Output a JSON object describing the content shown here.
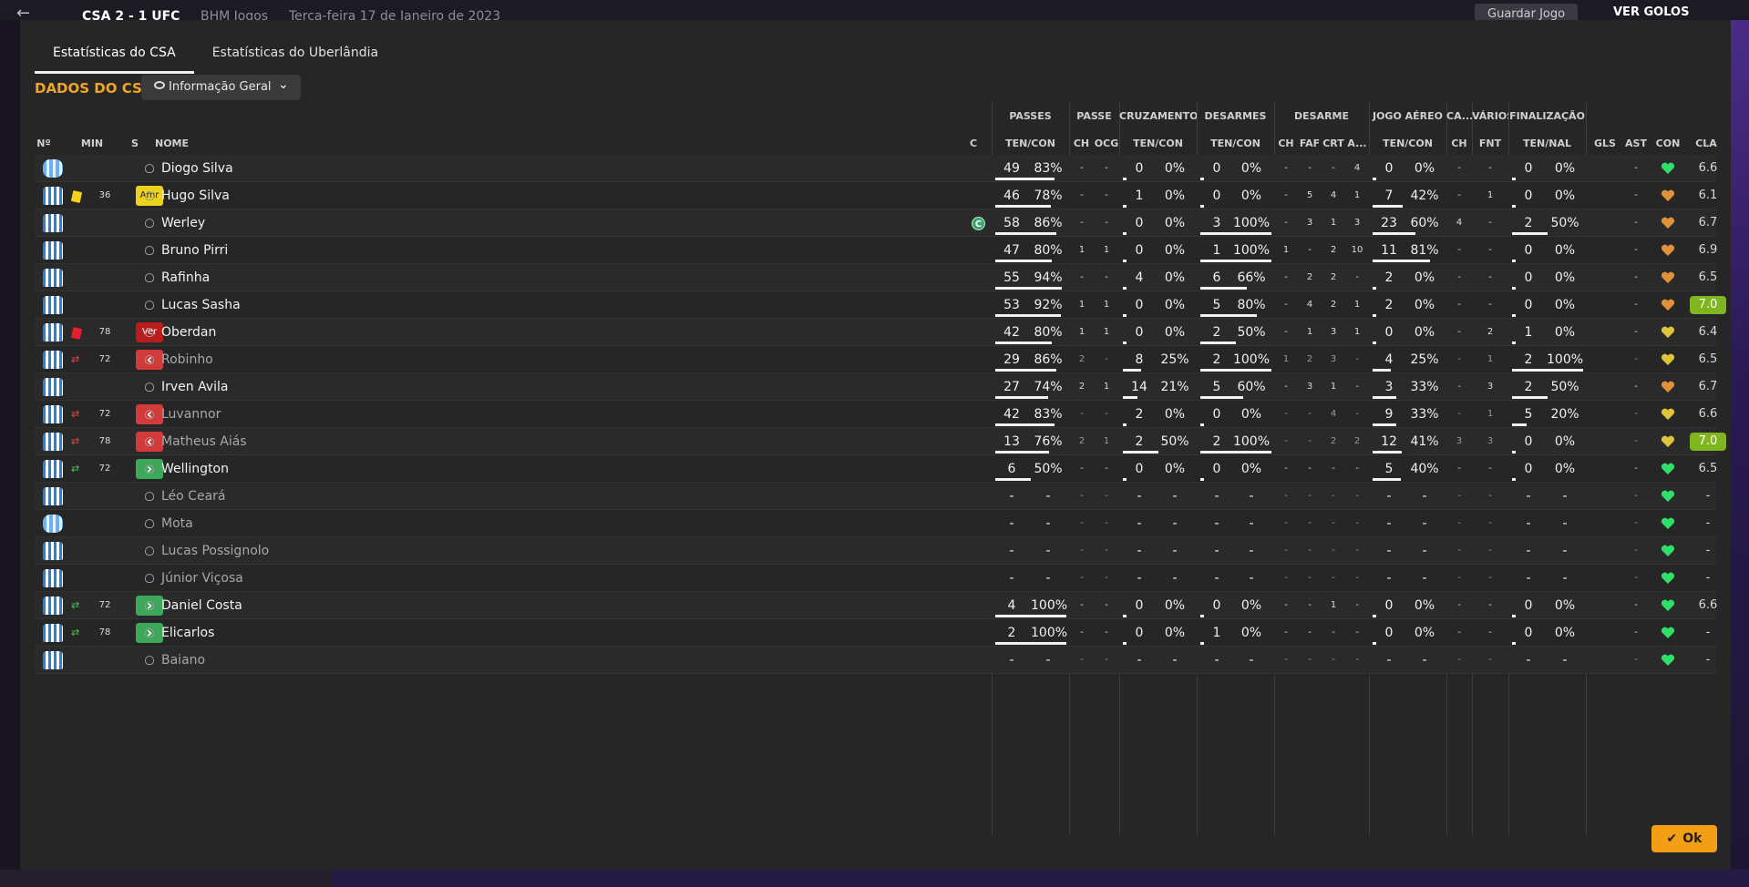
{
  "header": {
    "score": "CSA   2 - 1   UFC",
    "competition": "BHM Jogos",
    "date": "Terça-feira 17 de Janeiro de 2023",
    "save_label": "Guardar Jogo",
    "goals_label": "VER GOLOS"
  },
  "tabs": [
    "Estatísticas do CSA",
    "Estatísticas do Uberlândia"
  ],
  "team_title": "DADOS DO CSA",
  "view_dropdown": "Informação Geral",
  "groups": {
    "passes": "PASSES",
    "passe": "PASSE",
    "cruzamentos": "CRUZAMENTOS",
    "desarmes": "DESARMES",
    "desarme": "DESARME",
    "jogo_aereo": "JOGO AÉREO",
    "ca": "CA...",
    "varios": "VÁRIOS",
    "finalizacao": "FINALIZAÇÃO"
  },
  "columns": {
    "no": "Nº",
    "min": "MIN",
    "s": "S",
    "nome": "NOME",
    "c": "C",
    "pass_tencon": "TEN/CON",
    "pass_ch": "CH",
    "pass_ocg": "OCG",
    "cruz_tencon": "TEN/CON",
    "des_tencon": "TEN/CON",
    "d_ch": "CH",
    "d_faf": "FAF",
    "d_crt": "CRT",
    "d_a": "A...",
    "aer_tencon": "TEN/CON",
    "ca_ch": "CH",
    "v_fnt": "FNT",
    "fin_tennal": "TEN/NAL",
    "gls": "GLS",
    "ast": "AST",
    "con": "CON",
    "cla": "CLA"
  },
  "players": [
    {
      "name": "Diogo Silva",
      "gk": true,
      "event": "",
      "minute": "",
      "badge": "",
      "sub": false,
      "captain": "",
      "p_t": "49",
      "p_p": "83%",
      "pch": "-",
      "ocg": "-",
      "cr_t": "0",
      "cr_p": "0%",
      "de_t": "0",
      "de_p": "0%",
      "d_ch": "-",
      "d_faf": "-",
      "d_crt": "-",
      "d_a": "4",
      "ae_t": "0",
      "ae_p": "0%",
      "ca": "-",
      "fnt": "-",
      "fi_t": "0",
      "fi_p": "0%",
      "gls": "",
      "ast": "-",
      "con": "green",
      "rating": "6.6",
      "hi": false
    },
    {
      "name": "Hugo Silva",
      "gk": false,
      "event": "yellow",
      "minute": "36",
      "badge": "Amr",
      "sub": false,
      "captain": "",
      "p_t": "46",
      "p_p": "78%",
      "pch": "-",
      "ocg": "-",
      "cr_t": "1",
      "cr_p": "0%",
      "de_t": "0",
      "de_p": "0%",
      "d_ch": "-",
      "d_faf": "5",
      "d_crt": "4",
      "d_a": "1",
      "ae_t": "7",
      "ae_p": "42%",
      "ca": "-",
      "fnt": "1",
      "fi_t": "0",
      "fi_p": "0%",
      "gls": "",
      "ast": "-",
      "con": "orange",
      "rating": "6.1",
      "hi": false
    },
    {
      "name": "Werley",
      "gk": false,
      "event": "",
      "minute": "",
      "badge": "",
      "sub": false,
      "captain": "C",
      "p_t": "58",
      "p_p": "86%",
      "pch": "-",
      "ocg": "-",
      "cr_t": "0",
      "cr_p": "0%",
      "de_t": "3",
      "de_p": "100%",
      "d_ch": "-",
      "d_faf": "3",
      "d_crt": "1",
      "d_a": "3",
      "ae_t": "23",
      "ae_p": "60%",
      "ca": "4",
      "fnt": "-",
      "fi_t": "2",
      "fi_p": "50%",
      "gls": "",
      "ast": "-",
      "con": "orange",
      "rating": "6.7",
      "hi": false
    },
    {
      "name": "Bruno Pirri",
      "gk": false,
      "event": "",
      "minute": "",
      "badge": "",
      "sub": false,
      "captain": "",
      "p_t": "47",
      "p_p": "80%",
      "pch": "1",
      "ocg": "1",
      "cr_t": "0",
      "cr_p": "0%",
      "de_t": "1",
      "de_p": "100%",
      "d_ch": "1",
      "d_faf": "-",
      "d_crt": "2",
      "d_a": "10",
      "ae_t": "11",
      "ae_p": "81%",
      "ca": "-",
      "fnt": "-",
      "fi_t": "0",
      "fi_p": "0%",
      "gls": "",
      "ast": "-",
      "con": "orange",
      "rating": "6.9",
      "hi": false
    },
    {
      "name": "Rafinha",
      "gk": false,
      "event": "",
      "minute": "",
      "badge": "",
      "sub": false,
      "captain": "",
      "p_t": "55",
      "p_p": "94%",
      "pch": "-",
      "ocg": "-",
      "cr_t": "4",
      "cr_p": "0%",
      "de_t": "6",
      "de_p": "66%",
      "d_ch": "-",
      "d_faf": "2",
      "d_crt": "2",
      "d_a": "-",
      "ae_t": "2",
      "ae_p": "0%",
      "ca": "-",
      "fnt": "-",
      "fi_t": "0",
      "fi_p": "0%",
      "gls": "",
      "ast": "-",
      "con": "orange",
      "rating": "6.5",
      "hi": false
    },
    {
      "name": "Lucas Sasha",
      "gk": false,
      "event": "",
      "minute": "",
      "badge": "",
      "sub": false,
      "captain": "",
      "p_t": "53",
      "p_p": "92%",
      "pch": "1",
      "ocg": "1",
      "cr_t": "0",
      "cr_p": "0%",
      "de_t": "5",
      "de_p": "80%",
      "d_ch": "-",
      "d_faf": "4",
      "d_crt": "2",
      "d_a": "1",
      "ae_t": "2",
      "ae_p": "0%",
      "ca": "-",
      "fnt": "-",
      "fi_t": "0",
      "fi_p": "0%",
      "gls": "",
      "ast": "-",
      "con": "orange",
      "rating": "7.0",
      "hi": true
    },
    {
      "name": "Oberdan",
      "gk": false,
      "event": "red",
      "minute": "78",
      "badge": "Ver",
      "sub": false,
      "captain": "",
      "p_t": "42",
      "p_p": "80%",
      "pch": "1",
      "ocg": "1",
      "cr_t": "0",
      "cr_p": "0%",
      "de_t": "2",
      "de_p": "50%",
      "d_ch": "-",
      "d_faf": "1",
      "d_crt": "3",
      "d_a": "1",
      "ae_t": "0",
      "ae_p": "0%",
      "ca": "-",
      "fnt": "2",
      "fi_t": "1",
      "fi_p": "0%",
      "gls": "",
      "ast": "-",
      "con": "yellow",
      "rating": "6.4",
      "hi": false
    },
    {
      "name": "Robinho",
      "gk": false,
      "event": "swap-out",
      "minute": "72",
      "badge": "out",
      "sub": true,
      "captain": "",
      "p_t": "29",
      "p_p": "86%",
      "pch": "2",
      "ocg": "-",
      "cr_t": "8",
      "cr_p": "25%",
      "de_t": "2",
      "de_p": "100%",
      "d_ch": "1",
      "d_faf": "2",
      "d_crt": "3",
      "d_a": "-",
      "ae_t": "4",
      "ae_p": "25%",
      "ca": "-",
      "fnt": "1",
      "fi_t": "2",
      "fi_p": "100%",
      "gls": "",
      "ast": "-",
      "con": "yellow",
      "rating": "6.5",
      "hi": false
    },
    {
      "name": "Irven Avila",
      "gk": false,
      "event": "",
      "minute": "",
      "badge": "",
      "sub": false,
      "captain": "",
      "p_t": "27",
      "p_p": "74%",
      "pch": "2",
      "ocg": "1",
      "cr_t": "14",
      "cr_p": "21%",
      "de_t": "5",
      "de_p": "60%",
      "d_ch": "-",
      "d_faf": "3",
      "d_crt": "1",
      "d_a": "-",
      "ae_t": "3",
      "ae_p": "33%",
      "ca": "-",
      "fnt": "3",
      "fi_t": "2",
      "fi_p": "50%",
      "gls": "",
      "ast": "-",
      "con": "orange",
      "rating": "6.7",
      "hi": false
    },
    {
      "name": "Luvannor",
      "gk": false,
      "event": "swap-out",
      "minute": "72",
      "badge": "out",
      "sub": true,
      "captain": "",
      "p_t": "42",
      "p_p": "83%",
      "pch": "-",
      "ocg": "-",
      "cr_t": "2",
      "cr_p": "0%",
      "de_t": "0",
      "de_p": "0%",
      "d_ch": "-",
      "d_faf": "-",
      "d_crt": "4",
      "d_a": "-",
      "ae_t": "9",
      "ae_p": "33%",
      "ca": "-",
      "fnt": "1",
      "fi_t": "5",
      "fi_p": "20%",
      "gls": "",
      "ast": "-",
      "con": "yellow",
      "rating": "6.6",
      "hi": false
    },
    {
      "name": "Matheus Aiás",
      "gk": false,
      "event": "swap-out",
      "minute": "78",
      "badge": "out",
      "sub": true,
      "captain": "",
      "p_t": "13",
      "p_p": "76%",
      "pch": "2",
      "ocg": "1",
      "cr_t": "2",
      "cr_p": "50%",
      "de_t": "2",
      "de_p": "100%",
      "d_ch": "-",
      "d_faf": "-",
      "d_crt": "2",
      "d_a": "2",
      "ae_t": "12",
      "ae_p": "41%",
      "ca": "3",
      "fnt": "3",
      "fi_t": "0",
      "fi_p": "0%",
      "gls": "",
      "ast": "-",
      "con": "yellow",
      "rating": "7.0",
      "hi": true
    },
    {
      "name": "Wellington",
      "gk": false,
      "event": "swap-in",
      "minute": "72",
      "badge": "in",
      "sub": false,
      "captain": "",
      "p_t": "6",
      "p_p": "50%",
      "pch": "-",
      "ocg": "-",
      "cr_t": "0",
      "cr_p": "0%",
      "de_t": "0",
      "de_p": "0%",
      "d_ch": "-",
      "d_faf": "-",
      "d_crt": "-",
      "d_a": "-",
      "ae_t": "5",
      "ae_p": "40%",
      "ca": "-",
      "fnt": "-",
      "fi_t": "0",
      "fi_p": "0%",
      "gls": "",
      "ast": "-",
      "con": "green",
      "rating": "6.5",
      "hi": false
    },
    {
      "name": "Léo Ceará",
      "gk": false,
      "event": "",
      "minute": "",
      "badge": "",
      "sub": true,
      "captain": "",
      "p_t": "-",
      "p_p": "-",
      "pch": "-",
      "ocg": "-",
      "cr_t": "-",
      "cr_p": "-",
      "de_t": "-",
      "de_p": "-",
      "d_ch": "-",
      "d_faf": "-",
      "d_crt": "-",
      "d_a": "-",
      "ae_t": "-",
      "ae_p": "-",
      "ca": "-",
      "fnt": "-",
      "fi_t": "-",
      "fi_p": "-",
      "gls": "",
      "ast": "-",
      "con": "green",
      "rating": "-",
      "hi": false
    },
    {
      "name": "Mota",
      "gk": true,
      "event": "",
      "minute": "",
      "badge": "",
      "sub": true,
      "captain": "",
      "p_t": "-",
      "p_p": "-",
      "pch": "-",
      "ocg": "-",
      "cr_t": "-",
      "cr_p": "-",
      "de_t": "-",
      "de_p": "-",
      "d_ch": "-",
      "d_faf": "-",
      "d_crt": "-",
      "d_a": "-",
      "ae_t": "-",
      "ae_p": "-",
      "ca": "-",
      "fnt": "-",
      "fi_t": "-",
      "fi_p": "-",
      "gls": "",
      "ast": "-",
      "con": "green",
      "rating": "-",
      "hi": false
    },
    {
      "name": "Lucas Possignolo",
      "gk": false,
      "event": "",
      "minute": "",
      "badge": "",
      "sub": true,
      "captain": "",
      "p_t": "-",
      "p_p": "-",
      "pch": "-",
      "ocg": "-",
      "cr_t": "-",
      "cr_p": "-",
      "de_t": "-",
      "de_p": "-",
      "d_ch": "-",
      "d_faf": "-",
      "d_crt": "-",
      "d_a": "-",
      "ae_t": "-",
      "ae_p": "-",
      "ca": "-",
      "fnt": "-",
      "fi_t": "-",
      "fi_p": "-",
      "gls": "",
      "ast": "-",
      "con": "green",
      "rating": "-",
      "hi": false
    },
    {
      "name": "Júnior Viçosa",
      "gk": false,
      "event": "",
      "minute": "",
      "badge": "",
      "sub": true,
      "captain": "",
      "p_t": "-",
      "p_p": "-",
      "pch": "-",
      "ocg": "-",
      "cr_t": "-",
      "cr_p": "-",
      "de_t": "-",
      "de_p": "-",
      "d_ch": "-",
      "d_faf": "-",
      "d_crt": "-",
      "d_a": "-",
      "ae_t": "-",
      "ae_p": "-",
      "ca": "-",
      "fnt": "-",
      "fi_t": "-",
      "fi_p": "-",
      "gls": "",
      "ast": "-",
      "con": "green",
      "rating": "-",
      "hi": false
    },
    {
      "name": "Daniel Costa",
      "gk": false,
      "event": "swap-in",
      "minute": "72",
      "badge": "in",
      "sub": false,
      "captain": "",
      "p_t": "4",
      "p_p": "100%",
      "pch": "-",
      "ocg": "-",
      "cr_t": "0",
      "cr_p": "0%",
      "de_t": "0",
      "de_p": "0%",
      "d_ch": "-",
      "d_faf": "-",
      "d_crt": "1",
      "d_a": "-",
      "ae_t": "0",
      "ae_p": "0%",
      "ca": "-",
      "fnt": "-",
      "fi_t": "0",
      "fi_p": "0%",
      "gls": "",
      "ast": "-",
      "con": "green",
      "rating": "6.6",
      "hi": false
    },
    {
      "name": "Elicarlos",
      "gk": false,
      "event": "swap-in",
      "minute": "78",
      "badge": "in",
      "sub": false,
      "captain": "",
      "p_t": "2",
      "p_p": "100%",
      "pch": "-",
      "ocg": "-",
      "cr_t": "0",
      "cr_p": "0%",
      "de_t": "1",
      "de_p": "0%",
      "d_ch": "-",
      "d_faf": "-",
      "d_crt": "-",
      "d_a": "-",
      "ae_t": "0",
      "ae_p": "0%",
      "ca": "-",
      "fnt": "-",
      "fi_t": "0",
      "fi_p": "0%",
      "gls": "",
      "ast": "-",
      "con": "green",
      "rating": "-",
      "hi": false
    },
    {
      "name": "Baiano",
      "gk": false,
      "event": "",
      "minute": "",
      "badge": "",
      "sub": true,
      "captain": "",
      "p_t": "-",
      "p_p": "-",
      "pch": "-",
      "ocg": "-",
      "cr_t": "-",
      "cr_p": "-",
      "de_t": "-",
      "de_p": "-",
      "d_ch": "-",
      "d_faf": "-",
      "d_crt": "-",
      "d_a": "-",
      "ae_t": "-",
      "ae_p": "-",
      "ca": "-",
      "fnt": "-",
      "fi_t": "-",
      "fi_p": "-",
      "gls": "",
      "ast": "-",
      "con": "green",
      "rating": "-",
      "hi": false
    }
  ],
  "badge_text": {
    "out": "‹",
    "in": "›"
  },
  "colors": {
    "accent": "#f0a524",
    "rating_high": "#7fb51e",
    "condition_green": "#2ee06a",
    "condition_orange": "#e0913a",
    "condition_yellow": "#e0c43a"
  },
  "ok_label": "Ok"
}
